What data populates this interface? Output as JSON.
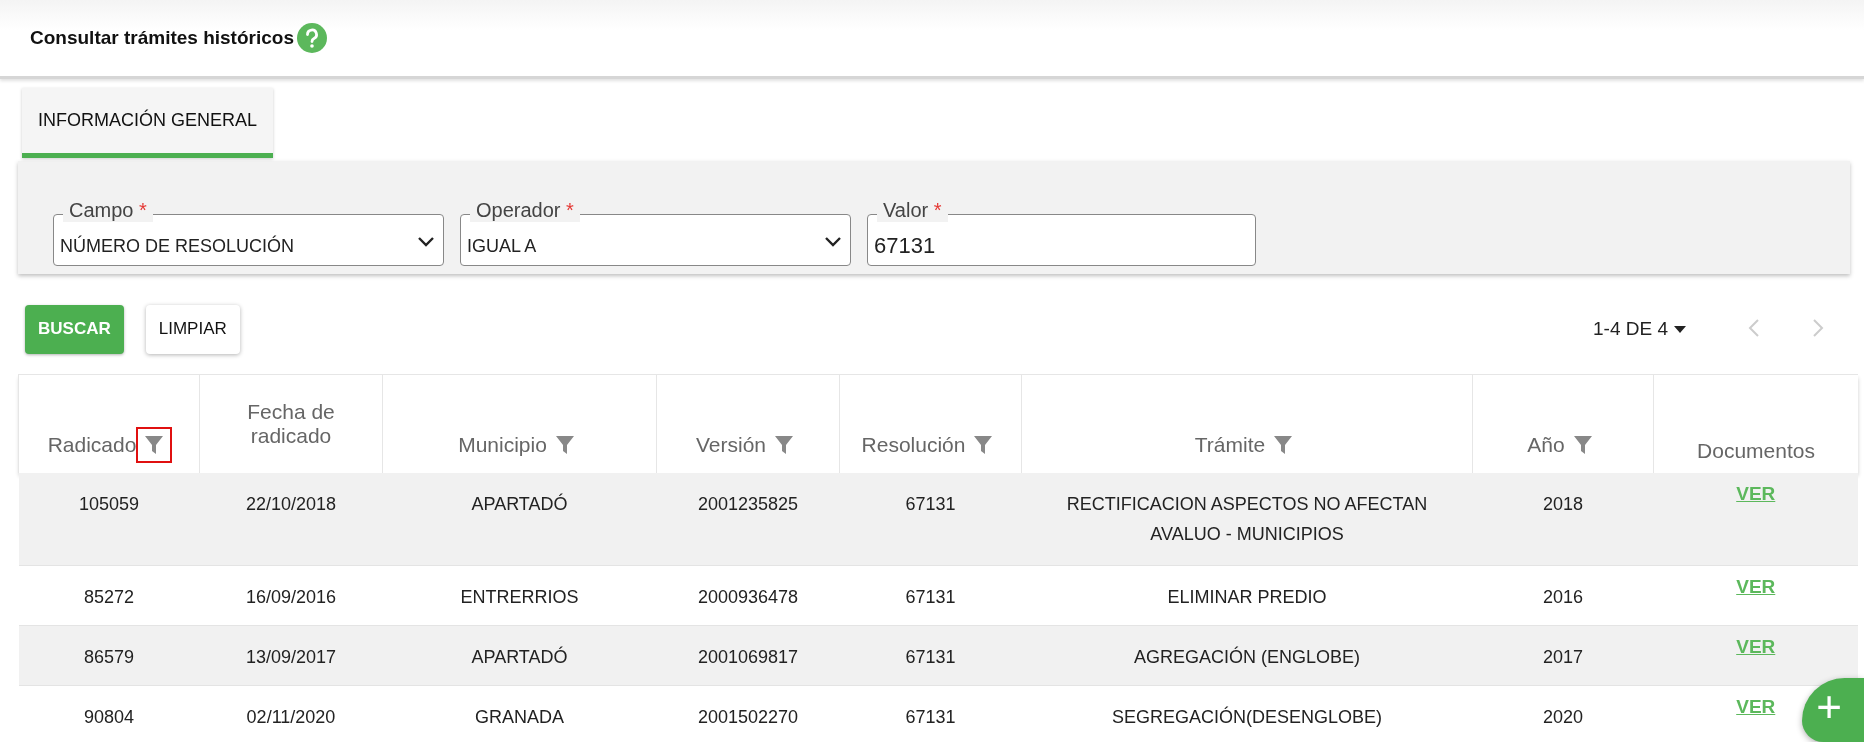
{
  "page_title": "Consultar trámites históricos",
  "tabs": [
    {
      "label": "INFORMACIÓN GENERAL",
      "selected": true
    }
  ],
  "filters": [
    {
      "label": "Campo",
      "required": "*",
      "value": "NÚMERO DE RESOLUCIÓN",
      "kind": "select"
    },
    {
      "label": "Operador",
      "required": "*",
      "value": "IGUAL A",
      "kind": "select"
    },
    {
      "label": "Valor",
      "required": "*",
      "value": "67131",
      "kind": "input"
    }
  ],
  "buttons": [
    {
      "label": "BUSCAR",
      "kind": "primary"
    },
    {
      "label": "LIMPIAR",
      "kind": "secondary"
    }
  ],
  "pagination": {
    "range": "1-4 DE 4",
    "prev_disabled": true,
    "next_disabled": true
  },
  "table": {
    "columns": [
      {
        "label": "Radicado",
        "filter": true,
        "highlighted": true
      },
      {
        "label": "Fecha de radicado",
        "filter": false,
        "highlighted": false
      },
      {
        "label": "Municipio",
        "filter": true,
        "highlighted": false
      },
      {
        "label": "Versión",
        "filter": true,
        "highlighted": false
      },
      {
        "label": "Resolución",
        "filter": true,
        "highlighted": false
      },
      {
        "label": "Trámite",
        "filter": true,
        "highlighted": false
      },
      {
        "label": "Año",
        "filter": true,
        "highlighted": false
      },
      {
        "label": "Documentos",
        "filter": false,
        "highlighted": false
      }
    ],
    "rows": [
      [
        "105059",
        "22/10/2018",
        "APARTADÓ",
        "2001235825",
        "67131",
        "RECTIFICACION ASPECTOS NO AFECTAN AVALUO - MUNICIPIOS",
        "2018",
        "VER"
      ],
      [
        "85272",
        "16/09/2016",
        "ENTRERRIOS",
        "2000936478",
        "67131",
        "ELIMINAR PREDIO",
        "2016",
        "VER"
      ],
      [
        "86579",
        "13/09/2017",
        "APARTADÓ",
        "2001069817",
        "67131",
        "AGREGACIÓN (ENGLOBE)",
        "2017",
        "VER"
      ],
      [
        "90804",
        "02/11/2020",
        "GRANADA",
        "2001502270",
        "67131",
        "SEGREGACIÓN(DESENGLOBE)",
        "2020",
        "VER"
      ]
    ]
  },
  "fab": {
    "label": "+"
  }
}
